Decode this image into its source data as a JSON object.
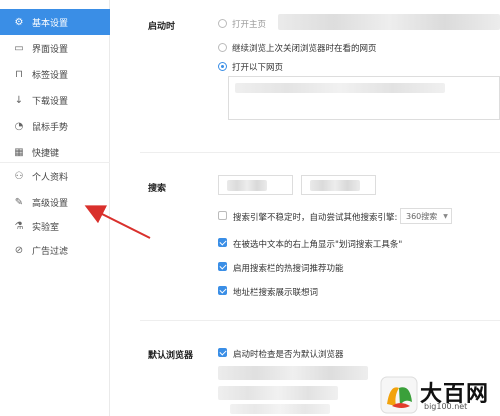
{
  "sidebar": {
    "items": [
      {
        "label": "基本设置",
        "icon": "gear-icon",
        "active": true
      },
      {
        "label": "界面设置",
        "icon": "window-icon"
      },
      {
        "label": "标签设置",
        "icon": "tab-icon"
      },
      {
        "label": "下载设置",
        "icon": "download-icon"
      },
      {
        "label": "鼠标手势",
        "icon": "mouse-icon"
      },
      {
        "label": "快捷键",
        "icon": "keyboard-icon"
      },
      {
        "label": "个人资料",
        "icon": "user-icon"
      },
      {
        "label": "高级设置",
        "icon": "wrench-icon"
      },
      {
        "label": "实验室",
        "icon": "flask-icon"
      },
      {
        "label": "广告过滤",
        "icon": "block-icon"
      }
    ]
  },
  "startup": {
    "label": "启动时",
    "options": [
      "打开主页",
      "继续浏览上次关闭浏览器时在看的网页",
      "打开以下网页"
    ],
    "selected_index": 2
  },
  "search": {
    "label": "搜索",
    "fallback_label": "搜索引擎不稳定时，自动尝试其他搜索引擎:",
    "fallback_select": "360搜索",
    "options": [
      {
        "label": "在被选中文本的右上角显示\"划词搜索工具条\"",
        "checked": true
      },
      {
        "label": "启用搜索栏的热搜词推荐功能",
        "checked": true
      },
      {
        "label": "地址栏搜索展示联想词",
        "checked": true
      }
    ],
    "fallback_checked": false
  },
  "default_browser": {
    "label": "默认浏览器",
    "check_label": "启动时检查是否为默认浏览器",
    "checked": true
  },
  "watermark": {
    "brand": "大百网",
    "url": "big100.net"
  },
  "colors": {
    "accent": "#3a8ee6",
    "arrow": "#d9302c"
  }
}
